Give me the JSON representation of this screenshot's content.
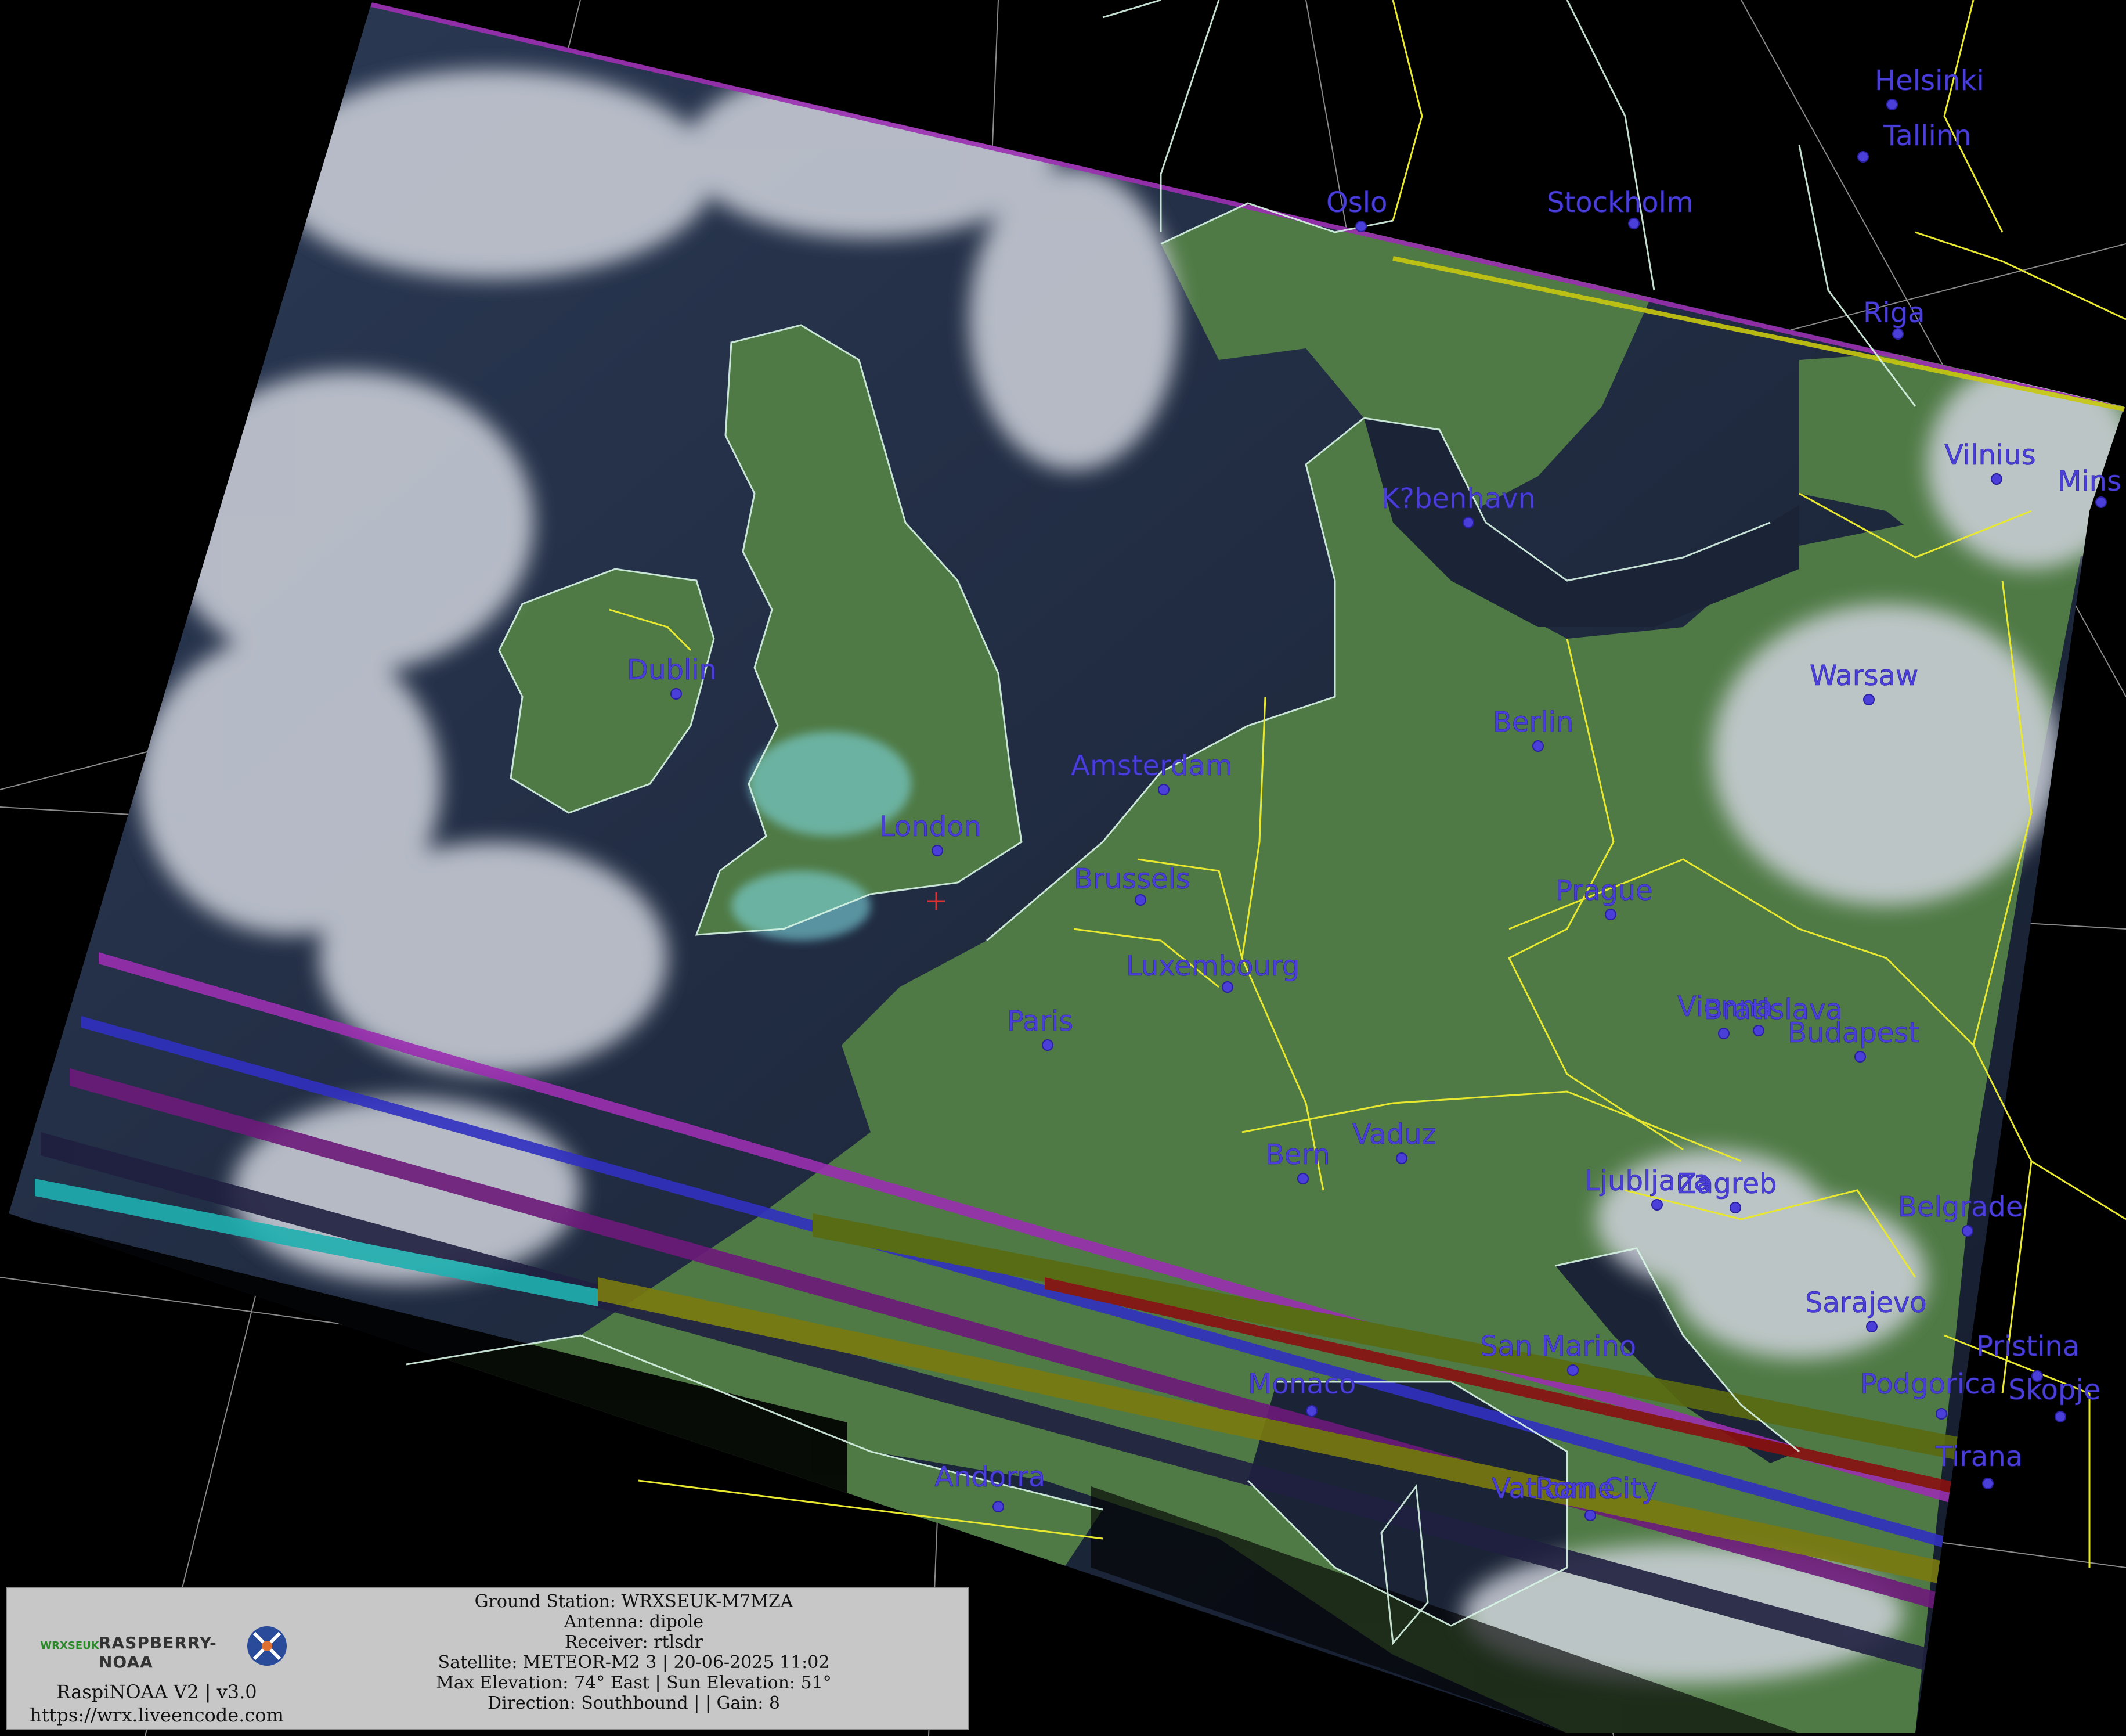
{
  "cities": [
    {
      "name": "Helsinki"
    },
    {
      "name": "Tallinn"
    },
    {
      "name": "Oslo"
    },
    {
      "name": "Stockholm"
    },
    {
      "name": "Riga"
    },
    {
      "name": "Vilnius"
    },
    {
      "name": "Mins"
    },
    {
      "name": "K?benhavn"
    },
    {
      "name": "Dublin"
    },
    {
      "name": "Warsaw"
    },
    {
      "name": "Berlin"
    },
    {
      "name": "Amsterdam"
    },
    {
      "name": "London"
    },
    {
      "name": "Brussels"
    },
    {
      "name": "Prague"
    },
    {
      "name": "Luxembourg"
    },
    {
      "name": "Paris"
    },
    {
      "name": "Vienna"
    },
    {
      "name": "Bratislava"
    },
    {
      "name": "Budapest"
    },
    {
      "name": "Vaduz"
    },
    {
      "name": "Bern"
    },
    {
      "name": "Ljubljana"
    },
    {
      "name": "Zagreb"
    },
    {
      "name": "Belgrade"
    },
    {
      "name": "Sarajevo"
    },
    {
      "name": "San Marino"
    },
    {
      "name": "Pristina"
    },
    {
      "name": "Monaco"
    },
    {
      "name": "Podgorica"
    },
    {
      "name": "Skopje"
    },
    {
      "name": "Tirana"
    },
    {
      "name": "Andorra"
    },
    {
      "name": "Vatican City"
    },
    {
      "name": "Rome"
    }
  ],
  "info": {
    "ground_station": "Ground Station: WRXSEUK-M7MZA",
    "antenna": "Antenna: dipole",
    "receiver": "Receiver: rtlsdr",
    "satellite": "Satellite: METEOR-M2 3 | 20-06-2025 11:02",
    "elevation": "Max Elevation: 74° East | Sun Elevation: 51°",
    "direction": "Direction: Southbound | | Gain: 8"
  },
  "brand": {
    "logo_left": "WRXSEUK",
    "logo_mid": "RASPBERRY-NOAA",
    "title": "RaspiNOAA V2 | v3.0",
    "url": "https://wrx.liveencode.com"
  },
  "colors": {
    "land": "#4f7a45",
    "sea": "#1b2436",
    "cloud": "#c9ccd6",
    "coast": "#d8f5e6",
    "border": "#e8e830",
    "label": "#4a3fd8",
    "graticule": "#b8b8b8"
  }
}
